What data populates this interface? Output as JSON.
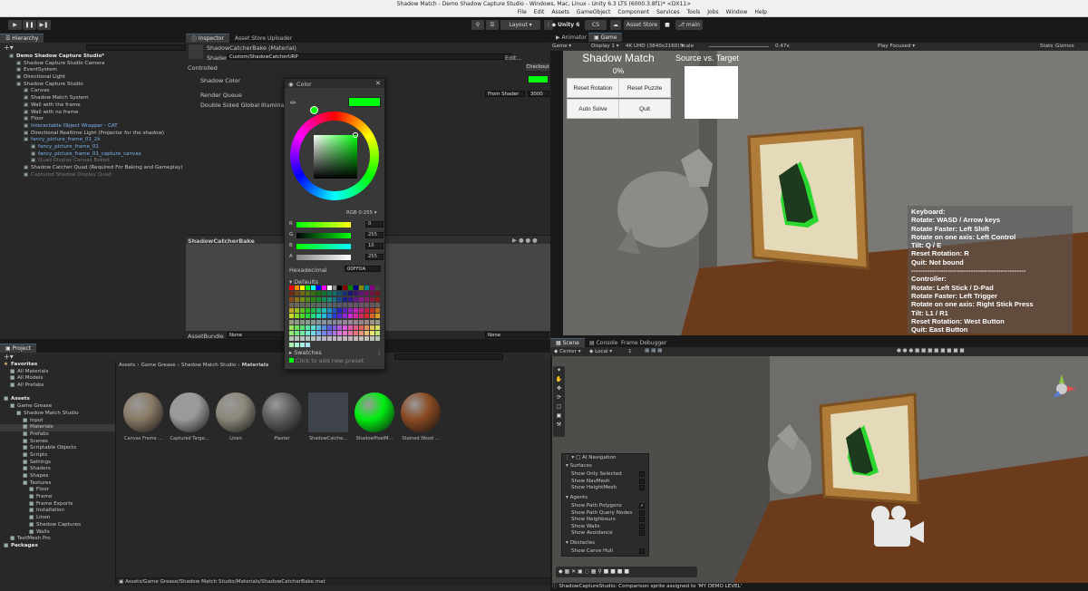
{
  "window": {
    "title": "Shadow Match - Demo Shadow Capture Studio - Windows, Mac, Linux - Unity 6.3 LTS (6000.3.8f1)* <DX11>"
  },
  "menu": [
    "File",
    "Edit",
    "Assets",
    "GameObject",
    "Component",
    "Services",
    "Tools",
    "Jobs",
    "Window",
    "Help"
  ],
  "toolbar": {
    "layout": "Layout",
    "unity_version": "Unity 6",
    "cs": "CS",
    "asset_store": "Asset Store",
    "branch": "main"
  },
  "hierarchy": {
    "tab": "Hierarchy",
    "items": [
      {
        "label": "Demo Shadow Capture Studio*",
        "indent": 0,
        "style": "bold"
      },
      {
        "label": "Shadow Capture Studio Camera",
        "indent": 1
      },
      {
        "label": "EventSystem",
        "indent": 1
      },
      {
        "label": "Directional Light",
        "indent": 1
      },
      {
        "label": "Shadow Capture Studio",
        "indent": 1
      },
      {
        "label": "Canvas",
        "indent": 2
      },
      {
        "label": "Shadow Match System",
        "indent": 2
      },
      {
        "label": "Wall with the frame",
        "indent": 2
      },
      {
        "label": "Wall with no frame",
        "indent": 2
      },
      {
        "label": "Floor",
        "indent": 2
      },
      {
        "label": "Interactable Object Wrapper - CAT",
        "indent": 2,
        "style": "blue"
      },
      {
        "label": "Directional Realtime Light (Projector for the shadow)",
        "indent": 2
      },
      {
        "label": "fancy_picture_frame_01_2k",
        "indent": 2,
        "style": "blue"
      },
      {
        "label": "fancy_picture_frame_01",
        "indent": 3,
        "style": "blue"
      },
      {
        "label": "fancy_picture_frame_01_capture_canvas",
        "indent": 3,
        "style": "blue"
      },
      {
        "label": "Quad Display Canvas Baked",
        "indent": 3,
        "style": "dim"
      },
      {
        "label": "Shadow Catcher Quad (Required For Baking and Gameplay)",
        "indent": 2
      },
      {
        "label": "Captured Shadow Display Quad",
        "indent": 2,
        "style": "dim"
      }
    ]
  },
  "inspector": {
    "tabs": [
      "Inspector",
      "Asset Store Uploader"
    ],
    "material_name": "ShadowCatcherBake (Material)",
    "shader_label": "Shader",
    "shader_value": "Custom/ShadowCatcherURP",
    "edit_btn": "Edit...",
    "controlled": "Controlled",
    "checkout": "Checkout",
    "shadow_color_label": "Shadow Color",
    "render_queue_label": "Render Queue",
    "render_queue_mode": "From Shader",
    "render_queue_value": "3000",
    "double_sided_label": "Double Sided Global Illumination",
    "preview_title": "ShadowCatcherBake",
    "assetbundle_label": "AssetBundle",
    "assetbundle_value": "None",
    "assetbundle_variant": "None"
  },
  "color_picker": {
    "title": "Color",
    "mode": "RGB 0-255",
    "r_label": "R",
    "g_label": "G",
    "b_label": "B",
    "a_label": "A",
    "r": "0",
    "g": "255",
    "b": "10",
    "a": "255",
    "hex_label": "Hexadecimal",
    "hex": "00FF0A",
    "defaults_label": "Defaults",
    "swatches_label": "Swatches",
    "add_preset": "Click to add new preset",
    "current_color": "#00FF0A"
  },
  "game_tabs": {
    "tabs": [
      "Animator",
      "Game"
    ],
    "game_mode": "Game",
    "display": "Display 1",
    "resolution": "4K UHD (3840x2160)",
    "scale_label": "Scale",
    "scale_value": "0.47x",
    "play_focused": "Play Focused",
    "stats": "Stats",
    "gizmos": "Gizmos"
  },
  "game": {
    "title": "Shadow Match",
    "percent": "0%",
    "source_target": "Source vs. Target",
    "buttons": [
      "Reset Rotation",
      "Reset Puzzle",
      "Auto Solve",
      "Quit"
    ],
    "help": [
      "Keyboard:",
      "Rotate: WASD / Arrow keys",
      "Rotate Faster: Left Shift",
      "Rotate on one axis: Left Control",
      "Tilt: Q / E",
      "Reset Rotation: R",
      "Quit: Not bound",
      "--------------------------------------------------",
      "Controller:",
      "Rotate: Left Stick / D-Pad",
      "Rotate Faster: Left Trigger",
      "Rotate on one axis: Right Stick Press",
      "Tilt: L1 / R1",
      "Reset Rotation: West Button",
      "Quit: East Button"
    ]
  },
  "scene_tabs": {
    "tabs": [
      "Scene",
      "Console",
      "Frame Debugger"
    ],
    "pivot": "Center",
    "space": "Local",
    "grid_value": "1"
  },
  "ai_nav": {
    "title": "AI Navigation",
    "surfaces": "Surfaces",
    "surface_items": [
      "Show Only Selected",
      "Show NavMesh",
      "Show HeightMesh"
    ],
    "agents": "Agents",
    "agent_items": [
      "Show Path Polygons",
      "Show Path Query Nodes",
      "Show Neighbours",
      "Show Walls",
      "Show Avoidance"
    ],
    "obstacles": "Obstacles",
    "obstacle_items": [
      "Show Carve Hull"
    ]
  },
  "project": {
    "tab": "Project",
    "breadcrumb": [
      "Assets",
      "Game Grease",
      "Shadow Match Studio",
      "Materials"
    ],
    "tree": [
      {
        "label": "Favorites",
        "indent": 0,
        "bold": true
      },
      {
        "label": "All Materials",
        "indent": 1
      },
      {
        "label": "All Models",
        "indent": 1
      },
      {
        "label": "All Prefabs",
        "indent": 1
      },
      {
        "label": "",
        "indent": 0
      },
      {
        "label": "Assets",
        "indent": 0,
        "bold": true
      },
      {
        "label": "Game Grease",
        "indent": 1
      },
      {
        "label": "Shadow Match Studio",
        "indent": 2
      },
      {
        "label": "Input",
        "indent": 3
      },
      {
        "label": "Materials",
        "indent": 3,
        "selected": true
      },
      {
        "label": "Prefabs",
        "indent": 3
      },
      {
        "label": "Scenes",
        "indent": 3
      },
      {
        "label": "Scriptable Objects",
        "indent": 3
      },
      {
        "label": "Scripts",
        "indent": 3
      },
      {
        "label": "Settings",
        "indent": 3
      },
      {
        "label": "Shaders",
        "indent": 3
      },
      {
        "label": "Shapes",
        "indent": 3
      },
      {
        "label": "Textures",
        "indent": 3
      },
      {
        "label": "Floor",
        "indent": 4
      },
      {
        "label": "Frame",
        "indent": 4
      },
      {
        "label": "Frame Exports",
        "indent": 4
      },
      {
        "label": "Installation",
        "indent": 4
      },
      {
        "label": "Linen",
        "indent": 4
      },
      {
        "label": "Shadow Captures",
        "indent": 4
      },
      {
        "label": "Walls",
        "indent": 4
      },
      {
        "label": "TextMesh Pro",
        "indent": 1
      },
      {
        "label": "Packages",
        "indent": 0,
        "bold": true
      }
    ],
    "assets": [
      {
        "label": "Canvas Frame ...",
        "color": "#8a7a66"
      },
      {
        "label": "Captured Targe...",
        "color": "#9a9a9a"
      },
      {
        "label": "Linen",
        "color": "#8c877a"
      },
      {
        "label": "Plaster",
        "color": "#5e5e5e"
      },
      {
        "label": "ShadowCatche...",
        "color": "#3f444c"
      },
      {
        "label": "ShadowPixelM...",
        "color": "#00ee10"
      },
      {
        "label": "Stained Wood ...",
        "color": "#8a4a22"
      }
    ],
    "path": "Assets/Game Grease/Shadow Match Studio/Materials/ShadowCatcherBake.mat"
  },
  "status": {
    "text": "ShadowCaptureStudio: Comparison sprite assigned to 'MY DEMO LEVEL'"
  }
}
